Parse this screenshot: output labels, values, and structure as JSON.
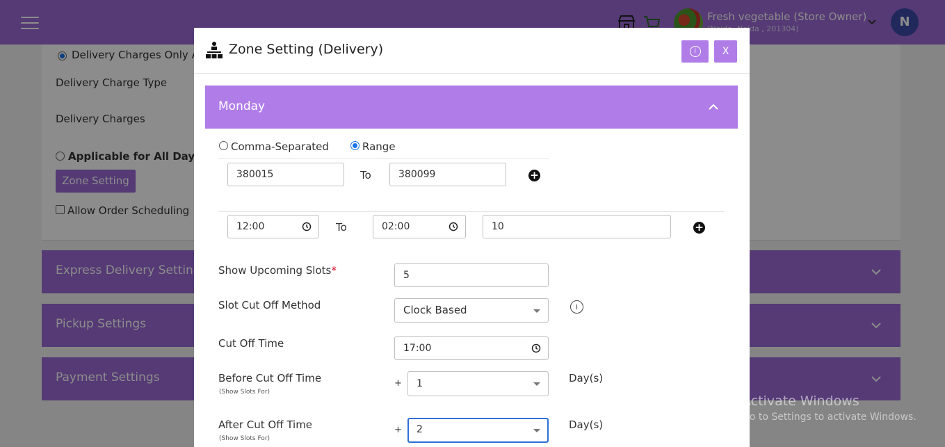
{
  "topbar": {
    "store_name": "Fresh vegetable (Store Owner)",
    "store_address": "(Noida, Noida , 201304)",
    "user_initial": "N",
    "brand_color": "#9b6ad6"
  },
  "background": {
    "delivery_only_label": "Delivery Charges Only Ap",
    "delivery_charge_type": "Delivery Charge Type",
    "delivery_charges": "Delivery Charges",
    "applicable_all_days": "Applicable for All Days",
    "zone_setting_button": "Zone Setting",
    "allow_order_scheduling": "Allow Order Scheduling",
    "accordions": [
      "Express Delivery Settings",
      "Pickup Settings",
      "Payment Settings"
    ]
  },
  "modal": {
    "title": "Zone Setting (Delivery)",
    "info_button": "i",
    "close_button": "X",
    "day": "Monday",
    "pincode_mode": {
      "comma_label": "Comma-Separated",
      "range_label": "Range",
      "selected": "Range"
    },
    "range_from": "380015",
    "range_to_label": "To",
    "range_to": "380099",
    "slot_from": "12:00",
    "slot_to_label": "To",
    "slot_to": "02:00",
    "slot_capacity": "10",
    "show_upcoming_label": "Show Upcoming Slots",
    "required_mark": "*",
    "show_upcoming_value": "5",
    "cutoff_method_label": "Slot Cut Off Method",
    "cutoff_method_value": "Clock Based",
    "cutoff_time_label": "Cut Off Time",
    "cutoff_time_value": "17:00",
    "before_cutoff_label": "Before Cut Off Time",
    "before_cutoff_sub": "(Show Slots For)",
    "before_plus": "+",
    "before_cutoff_value": "1",
    "before_days_label": "Day(s)",
    "after_cutoff_label": "After Cut Off Time",
    "after_cutoff_sub": "(Show Slots For)",
    "after_plus": "+",
    "after_cutoff_value": "2",
    "after_days_label": "Day(s)"
  },
  "watermark": {
    "line1": "Activate Windows",
    "line2": "Go to Settings to activate Windows."
  }
}
